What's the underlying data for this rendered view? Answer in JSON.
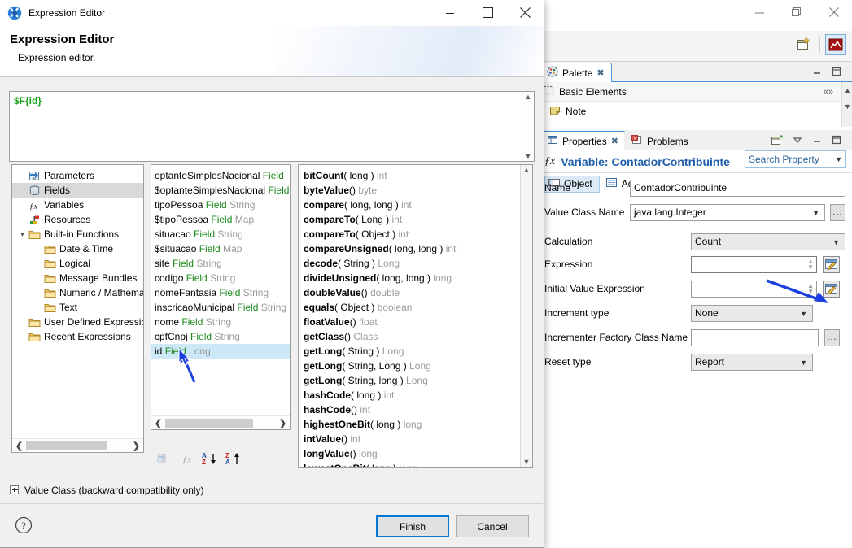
{
  "dialog": {
    "window_title": "Expression Editor",
    "heading": "Expression Editor",
    "subheading": "Expression editor.",
    "icon": "jaspersoft-icon",
    "minimize": "minimize-icon",
    "maximize": "maximize-icon",
    "close": "close-icon",
    "expression_value": "$F{id}",
    "value_class_label": "Value Class (backward compatibility only)",
    "help": "help-icon",
    "finish_label": "Finish",
    "cancel_label": "Cancel",
    "tree": [
      {
        "label": "Parameters",
        "icon": "parameters-icon",
        "indent": 1,
        "twisty": "",
        "selected": false
      },
      {
        "label": "Fields",
        "icon": "fields-icon",
        "indent": 1,
        "twisty": "",
        "selected": true
      },
      {
        "label": "Variables",
        "icon": "variables-fx-icon",
        "indent": 1,
        "twisty": "",
        "selected": false
      },
      {
        "label": "Resources",
        "icon": "resources-icon",
        "indent": 1,
        "twisty": "",
        "selected": false
      },
      {
        "label": "Built-in Functions",
        "icon": "folder-icon",
        "indent": 1,
        "twisty": "expanded",
        "selected": false
      },
      {
        "label": "Date & Time",
        "icon": "folder-icon",
        "indent": 2,
        "twisty": "",
        "selected": false
      },
      {
        "label": "Logical",
        "icon": "folder-icon",
        "indent": 2,
        "twisty": "",
        "selected": false
      },
      {
        "label": "Message Bundles",
        "icon": "folder-icon",
        "indent": 2,
        "twisty": "",
        "selected": false
      },
      {
        "label": "Numeric / Mathematical",
        "icon": "folder-icon",
        "indent": 2,
        "twisty": "",
        "selected": false
      },
      {
        "label": "Text",
        "icon": "folder-icon",
        "indent": 2,
        "twisty": "",
        "selected": false
      },
      {
        "label": "User Defined Expressions",
        "icon": "folder-icon",
        "indent": 1,
        "twisty": "",
        "selected": false
      },
      {
        "label": "Recent Expressions",
        "icon": "folder-icon",
        "indent": 1,
        "twisty": "",
        "selected": false
      }
    ],
    "fields": [
      {
        "name": "optanteSimplesNacional",
        "kw": "Field",
        "type": "",
        "selected": false
      },
      {
        "name": "$optanteSimplesNacional",
        "kw": "Field",
        "type": "",
        "selected": false
      },
      {
        "name": "tipoPessoa",
        "kw": "Field",
        "type": "String",
        "selected": false
      },
      {
        "name": "$tipoPessoa",
        "kw": "Field",
        "type": "Map",
        "selected": false
      },
      {
        "name": "situacao",
        "kw": "Field",
        "type": "String",
        "selected": false
      },
      {
        "name": "$situacao",
        "kw": "Field",
        "type": "Map",
        "selected": false
      },
      {
        "name": "site",
        "kw": "Field",
        "type": "String",
        "selected": false
      },
      {
        "name": "codigo",
        "kw": "Field",
        "type": "String",
        "selected": false
      },
      {
        "name": "nomeFantasia",
        "kw": "Field",
        "type": "String",
        "selected": false
      },
      {
        "name": "inscricaoMunicipal",
        "kw": "Field",
        "type": "String",
        "selected": false
      },
      {
        "name": "nome",
        "kw": "Field",
        "type": "String",
        "selected": false
      },
      {
        "name": "cpfCnpj",
        "kw": "Field",
        "type": "String",
        "selected": false
      },
      {
        "name": "id",
        "kw": "Field",
        "type": "Long",
        "selected": true
      }
    ],
    "sort_tools": [
      {
        "icon": "insert-parameter-icon",
        "enabled": false
      },
      {
        "icon": "insert-function-icon",
        "enabled": false
      },
      {
        "icon": "sort-az-descending-icon",
        "enabled": true
      },
      {
        "icon": "sort-za-ascending-icon",
        "enabled": true
      }
    ],
    "methods": [
      {
        "name": "bitCount",
        "args": "( long )",
        "ret": "int"
      },
      {
        "name": "byteValue",
        "args": "()",
        "ret": "byte"
      },
      {
        "name": "compare",
        "args": "( long, long )",
        "ret": "int"
      },
      {
        "name": "compareTo",
        "args": "( Long )",
        "ret": "int"
      },
      {
        "name": "compareTo",
        "args": "( Object )",
        "ret": "int"
      },
      {
        "name": "compareUnsigned",
        "args": "( long, long )",
        "ret": "int"
      },
      {
        "name": "decode",
        "args": "( String )",
        "ret": "Long"
      },
      {
        "name": "divideUnsigned",
        "args": "( long, long )",
        "ret": "long"
      },
      {
        "name": "doubleValue",
        "args": "()",
        "ret": "double"
      },
      {
        "name": "equals",
        "args": "( Object )",
        "ret": "boolean"
      },
      {
        "name": "floatValue",
        "args": "()",
        "ret": "float"
      },
      {
        "name": "getClass",
        "args": "()",
        "ret": "Class"
      },
      {
        "name": "getLong",
        "args": "( String )",
        "ret": "Long"
      },
      {
        "name": "getLong",
        "args": "( String, Long )",
        "ret": "Long"
      },
      {
        "name": "getLong",
        "args": "( String, long )",
        "ret": "Long"
      },
      {
        "name": "hashCode",
        "args": "( long )",
        "ret": "int"
      },
      {
        "name": "hashCode",
        "args": "()",
        "ret": "int"
      },
      {
        "name": "highestOneBit",
        "args": "( long )",
        "ret": "long"
      },
      {
        "name": "intValue",
        "args": "()",
        "ret": "int"
      },
      {
        "name": "longValue",
        "args": "()",
        "ret": "long"
      },
      {
        "name": "lowestOneBit",
        "args": "( long )",
        "ret": "long"
      }
    ]
  },
  "eclipse": {
    "minimize": "minimize-icon",
    "restore": "restore-icon",
    "close": "close-icon",
    "toolbar": [
      {
        "icon": "new-view-icon",
        "active": false
      },
      {
        "icon": "report-preview-icon",
        "active": true
      }
    ],
    "palette": {
      "tab_label": "Palette",
      "tab_icon": "palette-icon",
      "tab_close": "close-icon",
      "minimize": "minimize-icon",
      "maximize": "maximize-icon",
      "group_label": "Basic Elements",
      "group_icon": "dashed-box-icon",
      "collapse_icon": "collapse-icon",
      "items": [
        {
          "label": "Note",
          "icon": "note-icon"
        }
      ]
    },
    "properties": {
      "tabs": [
        {
          "label": "Properties",
          "icon": "properties-icon",
          "selected": true,
          "close": "close-icon"
        },
        {
          "label": "Problems",
          "icon": "problems-icon",
          "selected": false
        }
      ],
      "view_menu": "view-menu-icon",
      "pin": "pin-icon",
      "minimize": "minimize-icon",
      "maximize": "maximize-icon",
      "title_icon": "fx-icon",
      "title": "Variable: ContadorContribuinte",
      "search_placeholder": "Search Property",
      "object_tabs": [
        {
          "label": "Object",
          "icon": "object-icon",
          "selected": true
        },
        {
          "label": "Advanced",
          "icon": "advanced-icon",
          "selected": false
        }
      ],
      "fields": {
        "name_label": "Name",
        "name_value": "ContadorContribuinte",
        "value_class_label": "Value Class Name",
        "value_class_value": "java.lang.Integer",
        "calculation_label": "Calculation",
        "calculation_value": "Count",
        "expression_label": "Expression",
        "expression_value": "",
        "initial_value_label": "Initial Value Expression",
        "initial_value_value": "",
        "increment_type_label": "Increment type",
        "increment_type_value": "None",
        "incrementer_label": "Incrementer Factory Class Name",
        "incrementer_value": "",
        "reset_type_label": "Reset type",
        "reset_type_value": "Report",
        "dots_label": "...",
        "edit_icon": "pencil-edit-icon"
      }
    }
  },
  "annotations": {
    "arrow_color": "#1b3fe0",
    "arrow_to_expression_button": "arrow-annotation",
    "arrow_to_id_field": "arrow-annotation",
    "cursor": "mouse-cursor"
  },
  "colors": {
    "accent_blue": "#1f5fa9",
    "selection_blue": "#cde8f7",
    "expression_green": "#1aa31a",
    "focus_blue": "#0078d7"
  }
}
